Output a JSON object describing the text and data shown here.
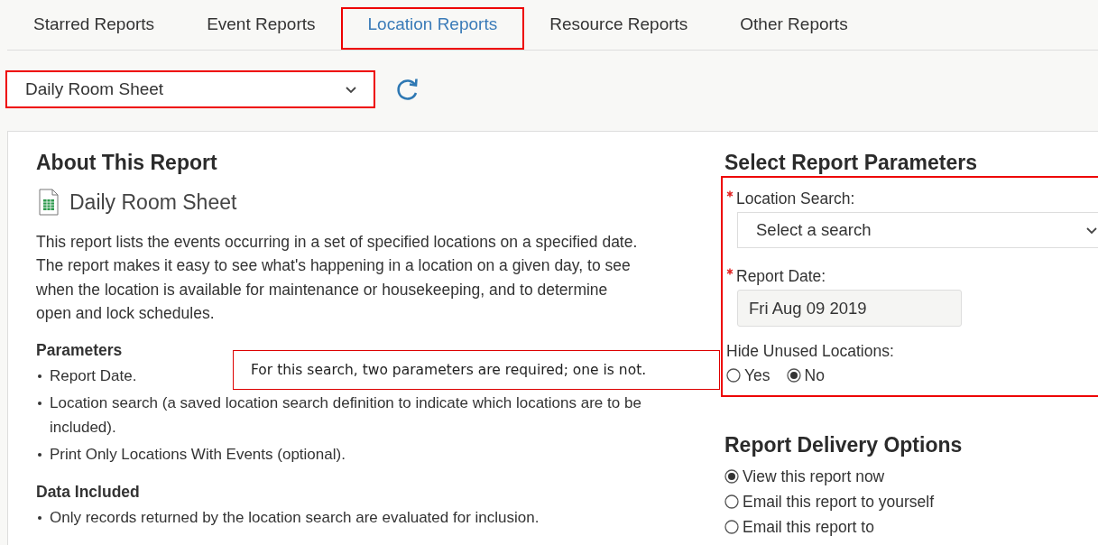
{
  "tabs": [
    {
      "label": "Starred Reports",
      "selected": false
    },
    {
      "label": "Event Reports",
      "selected": false
    },
    {
      "label": "Location Reports",
      "selected": true
    },
    {
      "label": "Resource Reports",
      "selected": false
    },
    {
      "label": "Other Reports",
      "selected": false
    }
  ],
  "report_select": {
    "value": "Daily Room Sheet"
  },
  "about": {
    "title": "About This Report",
    "report_name": "Daily Room Sheet",
    "description": "This report lists the events occurring in a set of specified locations on a specified date. The report makes it easy to see what's happening in a location on a given day, to see when the location is available for maintenance or housekeeping, and to determine open and lock schedules.",
    "sections": [
      {
        "heading": "Parameters",
        "items": [
          "Report Date.",
          "Location search (a saved location search definition to indicate which locations are to be included).",
          "Print Only Locations With Events (optional)."
        ]
      },
      {
        "heading": "Data Included",
        "items": [
          "Only records returned by the location search are evaluated for inclusion."
        ]
      }
    ]
  },
  "parameters": {
    "title": "Select Report Parameters",
    "fields": [
      {
        "kind": "select",
        "label": "Location Search:",
        "required": true,
        "value": "Select a search"
      },
      {
        "kind": "date",
        "label": "Report Date:",
        "required": true,
        "value": "Fri Aug 09 2019"
      },
      {
        "kind": "radio",
        "label": "Hide Unused Locations:",
        "required": false,
        "options": [
          {
            "label": "Yes",
            "selected": false
          },
          {
            "label": "No",
            "selected": true
          }
        ]
      }
    ]
  },
  "delivery": {
    "title": "Report Delivery Options",
    "options": [
      {
        "label": "View this report now",
        "selected": true
      },
      {
        "label": "Email this report to yourself",
        "selected": false
      },
      {
        "label": "Email this report to",
        "selected": false
      }
    ]
  },
  "callout": {
    "text": "For this search, two parameters are required; one is not."
  }
}
